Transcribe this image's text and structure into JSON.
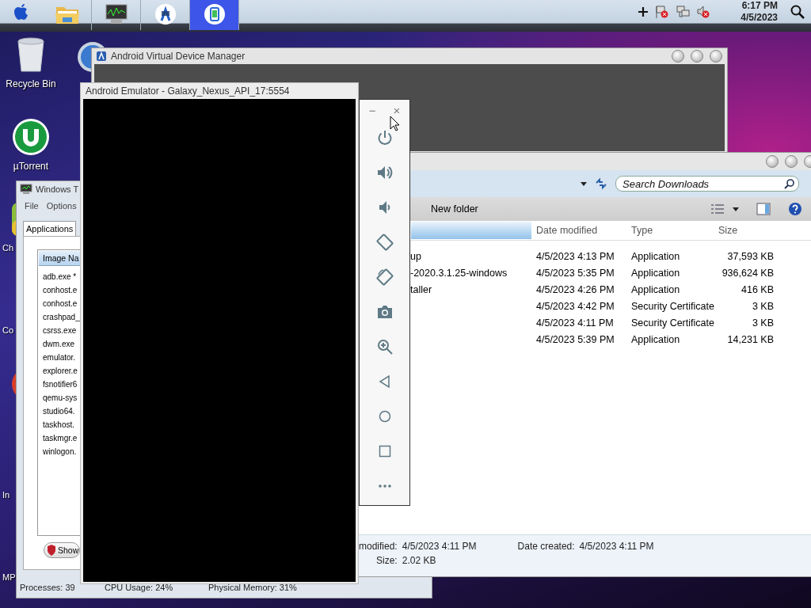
{
  "top_bar": {
    "apps": [
      {
        "kind": "folder",
        "selected": false
      },
      {
        "kind": "monitor",
        "selected": false
      },
      {
        "kind": "studio",
        "selected": false
      },
      {
        "kind": "emulator",
        "selected": true
      }
    ],
    "time": "6:17 PM",
    "date": "4/5/2023"
  },
  "desktop_icons": [
    {
      "kind": "bin",
      "label": "Recycle Bin"
    },
    {
      "kind": "torrent",
      "label": "µTorrent"
    },
    {
      "kind": "chrome",
      "label": "Ch"
    },
    {
      "kind": "none",
      "label": "Co"
    },
    {
      "kind": "red"
    },
    {
      "kind": "none",
      "label": "In"
    },
    {
      "kind": "none",
      "label": "MP"
    }
  ],
  "avd_manager": {
    "title": "Android Virtual Device Manager"
  },
  "task_manager": {
    "title": "Windows T",
    "menu": [
      "File",
      "Options"
    ],
    "tabs": [
      {
        "label": "Applications",
        "selected": true
      }
    ],
    "column": "Image Na",
    "processes": [
      "adb.exe *",
      "conhost.e",
      "conhost.e",
      "crashpad_",
      "csrss.exe",
      "dwm.exe",
      "emulator.",
      "explorer.e",
      "fsnotifier6",
      "qemu-sys",
      "studio64.",
      "taskhost.",
      "taskmgr.e",
      "winlogon."
    ],
    "show_button": "Show",
    "status": [
      "Processes: 39",
      "CPU Usage: 24%",
      "Physical Memory: 31%"
    ]
  },
  "explorer": {
    "search_placeholder": "Search Downloads",
    "toolbar": [
      "New folder"
    ],
    "columns": [
      "Date modified",
      "Type",
      "Size"
    ],
    "rows": [
      {
        "name": "up",
        "date": "4/5/2023 4:13 PM",
        "type": "Application",
        "size": "37,593 KB"
      },
      {
        "name": "-2020.3.1.25-windows",
        "date": "4/5/2023 5:35 PM",
        "type": "Application",
        "size": "936,624 KB"
      },
      {
        "name": "taller",
        "date": "4/5/2023 4:26 PM",
        "type": "Application",
        "size": "416 KB"
      },
      {
        "date": "4/5/2023 4:42 PM",
        "type": "Security Certificate",
        "size": "3 KB"
      },
      {
        "date": "4/5/2023 4:11 PM",
        "type": "Security Certificate",
        "size": "3 KB"
      },
      {
        "date": "4/5/2023 5:39 PM",
        "type": "Application",
        "size": "14,231 KB"
      }
    ],
    "details": [
      {
        "label": "modified:",
        "value": "4/5/2023 4:11 PM"
      },
      {
        "label": "Date created:",
        "value": "4/5/2023 4:11 PM"
      },
      {
        "label": "Size:",
        "value": "2.02 KB"
      }
    ]
  },
  "emulator": {
    "title": "Android Emulator - Galaxy_Nexus_API_17:5554",
    "minimize": "−",
    "close": "×",
    "controls": [
      {
        "kind": "power"
      },
      {
        "kind": "volume_up"
      },
      {
        "kind": "volume_down"
      },
      {
        "kind": "rotate_left"
      },
      {
        "kind": "rotate_right"
      },
      {
        "kind": "camera"
      },
      {
        "kind": "zoom"
      },
      {
        "kind": "back"
      },
      {
        "kind": "home"
      },
      {
        "kind": "overview"
      },
      {
        "kind": "more"
      }
    ]
  }
}
